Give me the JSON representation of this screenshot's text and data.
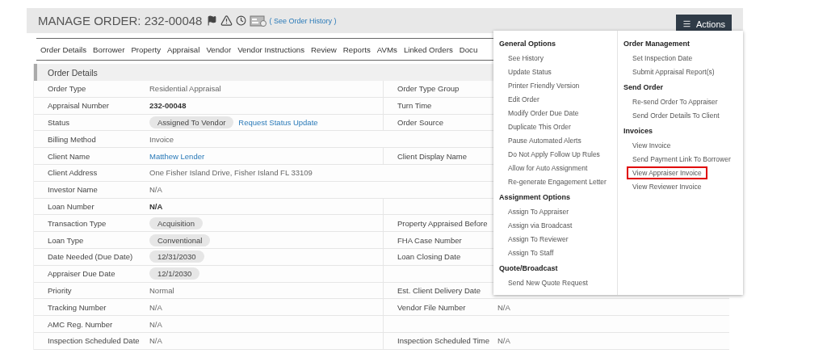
{
  "header": {
    "title": "MANAGE ORDER: 232-00048",
    "history_link": "( See Order History )",
    "actions_button": "Actions"
  },
  "tabs": [
    {
      "label": "Order Details"
    },
    {
      "label": "Borrower"
    },
    {
      "label": "Property"
    },
    {
      "label": "Appraisal"
    },
    {
      "label": "Vendor"
    },
    {
      "label": "Vendor Instructions"
    },
    {
      "label": "Review"
    },
    {
      "label": "Reports"
    },
    {
      "label": "AVMs"
    },
    {
      "label": "Linked Orders"
    },
    {
      "label": "Docu"
    }
  ],
  "section_title": "Order Details",
  "rows": [
    {
      "label": "Order Type",
      "value": [
        {
          "kind": "plain",
          "text": "Residential Appraisal"
        }
      ],
      "right_label": "Order Type Group"
    },
    {
      "label": "Appraisal Number",
      "value": [
        {
          "kind": "strong",
          "text": "232-00048"
        }
      ],
      "right_label": "Turn Time"
    },
    {
      "label": "Status",
      "value": [
        {
          "kind": "pill",
          "text": "Assigned To Vendor"
        },
        {
          "kind": "link",
          "text": "Request Status Update"
        }
      ],
      "right_label": "Order Source"
    },
    {
      "label": "Billing Method",
      "value": [
        {
          "kind": "plain",
          "text": "Invoice"
        }
      ]
    },
    {
      "label": "Client Name",
      "value": [
        {
          "kind": "link",
          "text": "Matthew Lender"
        }
      ],
      "right_label": "Client Display Name"
    },
    {
      "label": "Client Address",
      "value": [
        {
          "kind": "plain",
          "text": "One Fisher Island Drive, Fisher Island FL 33109"
        }
      ]
    },
    {
      "label": "Investor Name",
      "value": [
        {
          "kind": "plain",
          "text": "N/A"
        }
      ]
    },
    {
      "label": "Loan Number",
      "value": [
        {
          "kind": "strong",
          "text": "N/A"
        }
      ],
      "right_label": ""
    },
    {
      "label": "Transaction Type",
      "value": [
        {
          "kind": "pill",
          "text": "Acquisition"
        }
      ],
      "right_label": "Property Appraised Before"
    },
    {
      "label": "Loan Type",
      "value": [
        {
          "kind": "pill",
          "text": "Conventional"
        }
      ],
      "right_label": "FHA Case Number"
    },
    {
      "label": "Date Needed (Due Date)",
      "value": [
        {
          "kind": "pill",
          "text": "12/31/2030"
        }
      ],
      "right_label": "Loan Closing Date"
    },
    {
      "label": "Appraiser Due Date",
      "value": [
        {
          "kind": "pill",
          "text": "12/1/2030"
        }
      ],
      "right_label": ""
    },
    {
      "label": "Priority",
      "value": [
        {
          "kind": "plain",
          "text": "Normal"
        }
      ],
      "right_label": "Est. Client Delivery Date"
    },
    {
      "label": "Tracking Number",
      "value": [
        {
          "kind": "plain",
          "text": "N/A"
        }
      ],
      "right_label": "Vendor File Number",
      "right_value": "N/A"
    },
    {
      "label": "AMC Reg. Number",
      "value": [
        {
          "kind": "plain",
          "text": "N/A"
        }
      ],
      "right_label": ""
    },
    {
      "label": "Inspection Scheduled Date",
      "value": [
        {
          "kind": "plain",
          "text": "N/A"
        }
      ],
      "right_label": "Inspection Scheduled Time",
      "right_value": "N/A"
    }
  ],
  "actions_menu": {
    "columns": [
      [
        {
          "heading": "General Options",
          "items": [
            {
              "label": "See History",
              "highlighted": false
            },
            {
              "label": "Update Status",
              "highlighted": false
            },
            {
              "label": "Printer Friendly Version",
              "highlighted": false
            },
            {
              "label": "Edit Order",
              "highlighted": false
            },
            {
              "label": "Modify Order Due Date",
              "highlighted": false
            },
            {
              "label": "Duplicate This Order",
              "highlighted": false
            },
            {
              "label": "Pause Automated Alerts",
              "highlighted": false
            },
            {
              "label": "Do Not Apply Follow Up Rules",
              "highlighted": false
            },
            {
              "label": "Allow for Auto Assignment",
              "highlighted": false
            },
            {
              "label": "Re-generate Engagement Letter",
              "highlighted": false
            }
          ]
        },
        {
          "heading": "Assignment Options",
          "items": [
            {
              "label": "Assign To Appraiser",
              "highlighted": false
            },
            {
              "label": "Assign via Broadcast",
              "highlighted": false
            },
            {
              "label": "Assign To Reviewer",
              "highlighted": false
            },
            {
              "label": "Assign To Staff",
              "highlighted": false
            }
          ]
        },
        {
          "heading": "Quote/Broadcast",
          "items": [
            {
              "label": "Send New Quote Request",
              "highlighted": false
            }
          ]
        }
      ],
      [
        {
          "heading": "Order Management",
          "items": [
            {
              "label": "Set Inspection Date",
              "highlighted": false
            },
            {
              "label": "Submit Appraisal Report(s)",
              "highlighted": false
            }
          ]
        },
        {
          "heading": "Send Order",
          "items": [
            {
              "label": "Re-send Order To Appraiser",
              "highlighted": false
            },
            {
              "label": "Send Order Details To Client",
              "highlighted": false
            }
          ]
        },
        {
          "heading": "Invoices",
          "items": [
            {
              "label": "View Invoice",
              "highlighted": false
            },
            {
              "label": "Send Payment Link To Borrower",
              "highlighted": false
            },
            {
              "label": "View Appraiser Invoice",
              "highlighted": true
            },
            {
              "label": "View Reviewer Invoice",
              "highlighted": false
            }
          ]
        }
      ]
    ]
  }
}
